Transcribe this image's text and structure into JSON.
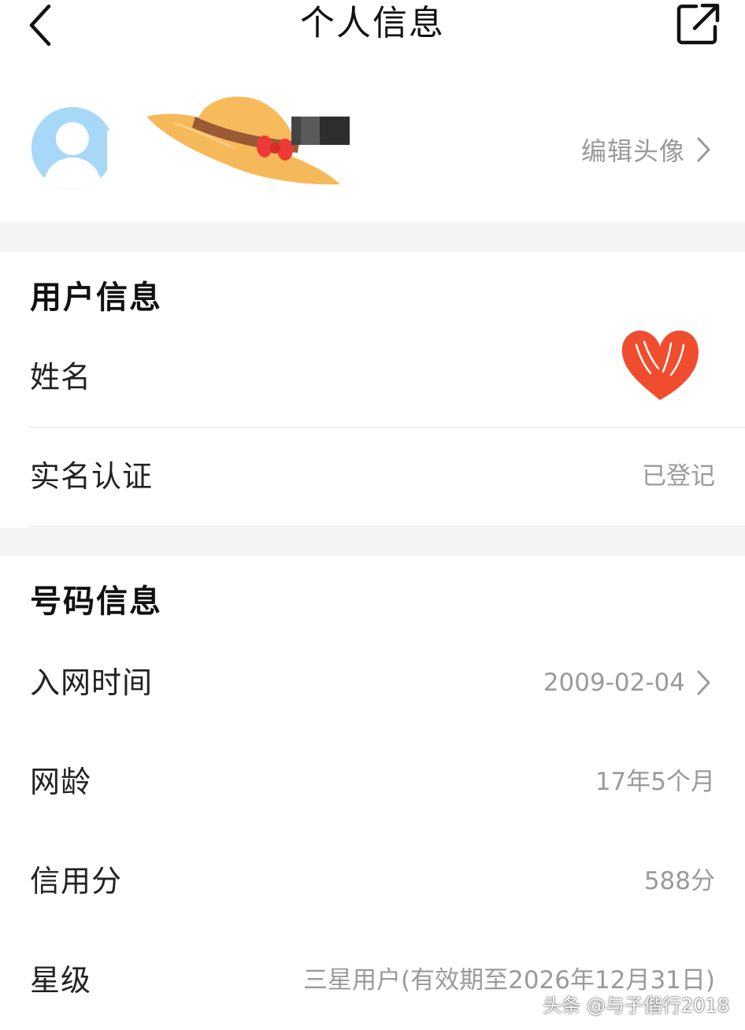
{
  "header": {
    "title": "个人信息",
    "back_icon": "chevron-left-icon",
    "share_icon": "share-external-icon"
  },
  "profile": {
    "edit_avatar_label": "编辑头像",
    "avatar_color": "#9ed3f6"
  },
  "user_info": {
    "title": "用户信息",
    "rows": [
      {
        "label": "姓名",
        "value": ""
      },
      {
        "label": "实名认证",
        "value": "已登记"
      }
    ]
  },
  "number_info": {
    "title": "号码信息",
    "rows": [
      {
        "label": "入网时间",
        "value": "2009-02-04"
      },
      {
        "label": "网龄",
        "value": "17年5个月"
      },
      {
        "label": "信用分",
        "value": "588分"
      },
      {
        "label": "星级",
        "value": "三星用户(有效期至2026年12月31日)"
      }
    ]
  },
  "watermark": "头条 @与子偕行2018",
  "colors": {
    "label_text": "#222222",
    "value_text": "#9a9a9a",
    "divider": "#e6e6e6",
    "section_gap": "#f4f4f4"
  }
}
